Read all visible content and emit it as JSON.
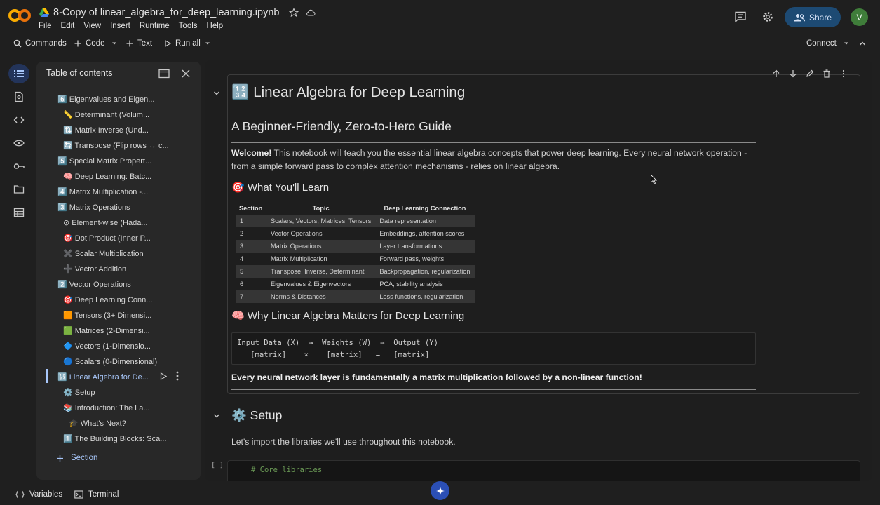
{
  "app": {
    "file_title": "8-Copy of linear_algebra_for_deep_learning.ipynb",
    "menus": [
      "File",
      "Edit",
      "View",
      "Insert",
      "Runtime",
      "Tools",
      "Help"
    ],
    "share_label": "Share",
    "avatar_initial": "V"
  },
  "toolbar": {
    "commands": "Commands",
    "code": "Code",
    "text": "Text",
    "run_all": "Run all",
    "connect": "Connect"
  },
  "toc": {
    "title": "Table of contents",
    "items": [
      "6️⃣ Eigenvalues and Eigen...",
      "📏 Determinant (Volum...",
      "🔃 Matrix Inverse (Und...",
      "🔄 Transpose (Flip rows ↔ c...",
      "5️⃣ Special Matrix Propert...",
      "🧠 Deep Learning: Batc...",
      "4️⃣ Matrix Multiplication -...",
      "3️⃣ Matrix Operations",
      "⊙ Element-wise (Hada...",
      "🎯 Dot Product (Inner P...",
      "✖️ Scalar Multiplication",
      "➕ Vector Addition",
      "2️⃣ Vector Operations",
      "🎯 Deep Learning Conn...",
      "🟧 Tensors (3+ Dimensi...",
      "🟩 Matrices (2-Dimensi...",
      "🔷 Vectors (1-Dimensio...",
      "🔵 Scalars (0-Dimensional)",
      "🔢 Linear Algebra for De...",
      "⚙️ Setup",
      "📚 Introduction: The La...",
      "🎓 What's Next?",
      "1️⃣ The Building Blocks: Sca..."
    ],
    "add_section": "Section"
  },
  "notebook": {
    "h1": "🔢 Linear Algebra for Deep Learning",
    "h2": "A Beginner-Friendly, Zero-to-Hero Guide",
    "welcome_bold": "Welcome!",
    "welcome_text": " This notebook will teach you the essential linear algebra concepts that power deep learning. Every neural network operation - from a simple forward pass to complex attention mechanisms - relies on linear algebra.",
    "learn_heading": "🎯 What You'll Learn",
    "table": {
      "headers": [
        "Section",
        "Topic",
        "Deep Learning Connection"
      ],
      "rows": [
        [
          "1",
          "Scalars, Vectors, Matrices, Tensors",
          "Data representation"
        ],
        [
          "2",
          "Vector Operations",
          "Embeddings, attention scores"
        ],
        [
          "3",
          "Matrix Operations",
          "Layer transformations"
        ],
        [
          "4",
          "Matrix Multiplication",
          "Forward pass, weights"
        ],
        [
          "5",
          "Transpose, Inverse, Determinant",
          "Backpropagation, regularization"
        ],
        [
          "6",
          "Eigenvalues & Eigenvectors",
          "PCA, stability analysis"
        ],
        [
          "7",
          "Norms & Distances",
          "Loss functions, regularization"
        ]
      ]
    },
    "why_heading": "🧠 Why Linear Algebra Matters for Deep Learning",
    "code_block": "Input Data (X)  →  Weights (W)  →  Output (Y)\n   [matrix]    ×    [matrix]   =   [matrix]",
    "bold_line": "Every neural network layer is fundamentally a matrix multiplication followed by a non-linear function!",
    "setup_heading": "⚙️ Setup",
    "setup_text": "Let's import the libraries we'll use throughout this notebook.",
    "code_bracket": "[ ]",
    "code_comment": "# Core libraries"
  },
  "bottom": {
    "variables": "Variables",
    "terminal": "Terminal"
  },
  "colors": {
    "accent": "#a8c7fa",
    "share_bg": "#1d4a73",
    "avatar_bg": "#3f7d3a",
    "logo_orange": "#f9ab00"
  }
}
